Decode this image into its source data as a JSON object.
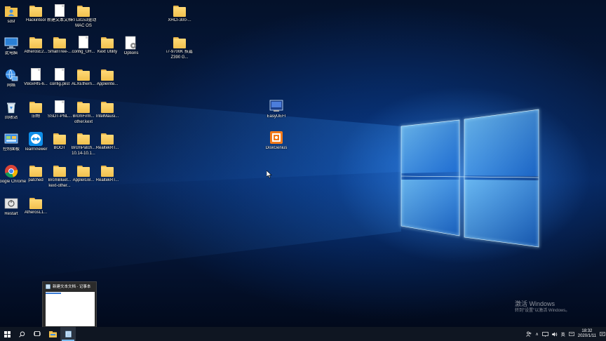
{
  "desktop_icons": [
    {
      "name": "desktop-icon-sdsf",
      "label": "sdsf",
      "kind": "user",
      "col": 0,
      "row": 0
    },
    {
      "name": "desktop-icon-hackintool",
      "label": "Hackintool",
      "kind": "folder",
      "col": 1,
      "row": 0
    },
    {
      "name": "desktop-icon-new-text-doc",
      "label": "新建文本文档",
      "kind": "doc",
      "col": 2,
      "row": 0
    },
    {
      "name": "desktop-icon-rtl8153",
      "label": "RTL8153驱动 MAC OS",
      "kind": "zip",
      "col": 3,
      "row": 0
    },
    {
      "name": "desktop-icon-xhci",
      "label": "XHCI-300-...",
      "kind": "zip",
      "col": 7,
      "row": 0
    },
    {
      "name": "desktop-icon-this-pc",
      "label": "此电脑",
      "kind": "pc",
      "col": 0,
      "row": 1
    },
    {
      "name": "desktop-icon-atheros-e2",
      "label": "AtherosE2...",
      "kind": "folder",
      "col": 1,
      "row": 1
    },
    {
      "name": "desktop-icon-smalltree",
      "label": "SmallTree-...",
      "kind": "folder",
      "col": 2,
      "row": 1
    },
    {
      "name": "desktop-icon-config-uh",
      "label": "config_UH...",
      "kind": "doc",
      "col": 3,
      "row": 1
    },
    {
      "name": "desktop-icon-kext-utility",
      "label": "Kext Utility",
      "kind": "folder",
      "col": 4,
      "row": 1
    },
    {
      "name": "desktop-icon-options",
      "label": "Options",
      "kind": "options",
      "col": 5,
      "row": 1
    },
    {
      "name": "desktop-icon-i7-9700k",
      "label": "i7-9700K 技嘉 Z390 G...",
      "kind": "zip",
      "col": 7,
      "row": 1
    },
    {
      "name": "desktop-icon-network",
      "label": "网络",
      "kind": "network",
      "col": 0,
      "row": 2
    },
    {
      "name": "desktop-icon-voodoohfs",
      "label": "VBoxHfs-6...",
      "kind": "doc",
      "col": 1,
      "row": 2
    },
    {
      "name": "desktop-icon-config-plist",
      "label": "config.plist",
      "kind": "doc",
      "col": 2,
      "row": 2
    },
    {
      "name": "desktop-icon-alxethern",
      "label": "ALXEthern...",
      "kind": "folder",
      "col": 3,
      "row": 2
    },
    {
      "name": "desktop-icon-appleinte",
      "label": "AppleInte...",
      "kind": "folder",
      "col": 4,
      "row": 2
    },
    {
      "name": "desktop-icon-recycle-bin",
      "label": "回收站",
      "kind": "recycle",
      "col": 0,
      "row": 3
    },
    {
      "name": "desktop-icon-old",
      "label": "旧物",
      "kind": "folder",
      "col": 1,
      "row": 3
    },
    {
      "name": "desktop-icon-ssdt-pnl",
      "label": "SSDT-PNL...",
      "kind": "doc",
      "col": 2,
      "row": 3
    },
    {
      "name": "desktop-icon-brcmfirm",
      "label": "BrcmFirm... other.kext",
      "kind": "folder",
      "col": 3,
      "row": 3
    },
    {
      "name": "desktop-icon-intelmausi",
      "label": "IntelMausi...",
      "kind": "folder",
      "col": 4,
      "row": 3
    },
    {
      "name": "desktop-icon-control-panel",
      "label": "控制面板",
      "kind": "control",
      "col": 0,
      "row": 4
    },
    {
      "name": "desktop-icon-teamviewer",
      "label": "TeamViewer",
      "kind": "teamviewer",
      "col": 1,
      "row": 4
    },
    {
      "name": "desktop-icon-boot",
      "label": "BOOT",
      "kind": "folder",
      "col": 2,
      "row": 4
    },
    {
      "name": "desktop-icon-brcmpatch",
      "label": "BrcmPatch... 10.14-10.1...",
      "kind": "folder",
      "col": 3,
      "row": 4
    },
    {
      "name": "desktop-icon-realtekrt-1",
      "label": "RealtekRT...",
      "kind": "folder",
      "col": 4,
      "row": 4
    },
    {
      "name": "desktop-icon-google-chrome",
      "label": "Google Chrome",
      "kind": "chrome",
      "col": 0,
      "row": 5
    },
    {
      "name": "desktop-icon-patched",
      "label": "patched",
      "kind": "folder",
      "col": 1,
      "row": 5
    },
    {
      "name": "desktop-icon-brcmbluet",
      "label": "BrcmBluet... kext-other...",
      "kind": "folder",
      "col": 2,
      "row": 5
    },
    {
      "name": "desktop-icon-appleigb",
      "label": "AppleIGB...",
      "kind": "folder",
      "col": 3,
      "row": 5
    },
    {
      "name": "desktop-icon-realtekrt-2",
      "label": "RealtekRT...",
      "kind": "folder",
      "col": 4,
      "row": 5
    },
    {
      "name": "desktop-icon-restart",
      "label": "Restart",
      "kind": "restart",
      "col": 0,
      "row": 6
    },
    {
      "name": "desktop-icon-atherosl1",
      "label": "AtherosL1...",
      "kind": "folder",
      "col": 1,
      "row": 6
    }
  ],
  "mid_icons": [
    {
      "name": "desktop-icon-easyuefi",
      "label": "EasyUEFI",
      "kind": "easyuefi"
    },
    {
      "name": "desktop-icon-diskgenius",
      "label": "DiskGenius",
      "kind": "diskgenius"
    }
  ],
  "thumbnail": {
    "title": "新建文本文档 - 记事本"
  },
  "watermark": {
    "title": "激活 Windows",
    "subtitle": "转到\"设置\"以激活 Windows。"
  },
  "taskbar": {
    "tray_lang": "英",
    "clock_time": "18:32",
    "clock_date": "2020/1/11"
  },
  "colors": {
    "taskbar": "#0f1622",
    "folder": "#f2c14e",
    "accent": "#76b9ed"
  }
}
